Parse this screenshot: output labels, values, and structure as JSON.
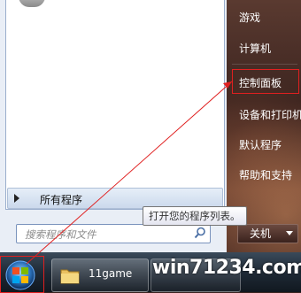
{
  "start_menu": {
    "top_item_label": "...",
    "all_programs_label": "所有程序",
    "search_placeholder": "搜索程序和文件",
    "tooltip": "打开您的程序列表。",
    "right_items": [
      {
        "label": "游戏"
      },
      {
        "label": "计算机"
      },
      {
        "label": "控制面板"
      },
      {
        "label": "设备和打印机"
      },
      {
        "label": "默认程序"
      },
      {
        "label": "帮助和支持"
      }
    ],
    "shutdown_label": "关机"
  },
  "taskbar": {
    "folder_button_label": "11game"
  },
  "watermark": "win71234.com",
  "colors": {
    "highlight_red": "#e02020",
    "menu_left_bg": "#ffffff",
    "taskbar_dark": "#1f2a36"
  }
}
